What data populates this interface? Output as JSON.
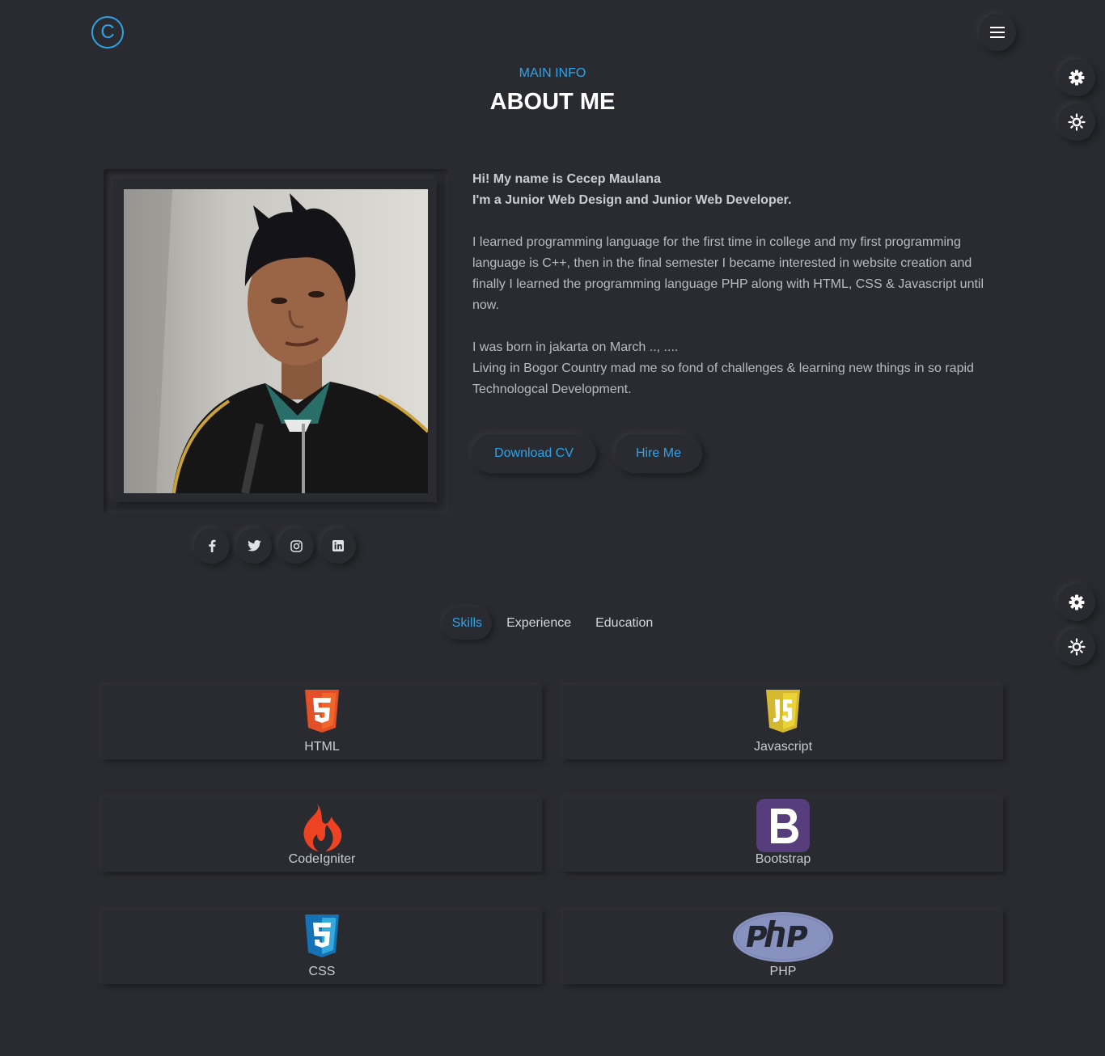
{
  "header": {
    "logo_letter": "C"
  },
  "section": {
    "subtitle": "MAIN INFO",
    "title": "ABOUT ME"
  },
  "about": {
    "intro_line1": "Hi! My name is Cecep Maulana",
    "intro_line2": "I'm a Junior Web Design and Junior Web Developer.",
    "paragraph1": "I learned programming language for the first time in college and my first programming language is C++, then in the final semester I became interested in website creation and finally I learned the programming language PHP along with HTML, CSS & Javascript until now.",
    "paragraph2_line1": "I was born in jakarta on March .., ....",
    "paragraph2_line2": "Living in Bogor Country mad me so fond of challenges & learning new things in so rapid Technologcal Development."
  },
  "buttons": {
    "download_cv": "Download CV",
    "hire_me": "Hire Me"
  },
  "social": [
    "facebook-icon",
    "twitter-icon",
    "instagram-icon",
    "linkedin-icon"
  ],
  "tabs": [
    {
      "label": "Skills",
      "active": true
    },
    {
      "label": "Experience",
      "active": false
    },
    {
      "label": "Education",
      "active": false
    }
  ],
  "skills": [
    {
      "label": "HTML",
      "icon": "html5-icon"
    },
    {
      "label": "Javascript",
      "icon": "javascript-icon"
    },
    {
      "label": "CodeIgniter",
      "icon": "codeigniter-icon"
    },
    {
      "label": "Bootstrap",
      "icon": "bootstrap-icon"
    },
    {
      "label": "CSS",
      "icon": "css3-icon"
    },
    {
      "label": "PHP",
      "icon": "php-icon"
    }
  ],
  "colors": {
    "background": "#2a2b30",
    "accent": "#2ea3e8",
    "heading": "#ffffff",
    "text": "#c9ccd1"
  }
}
